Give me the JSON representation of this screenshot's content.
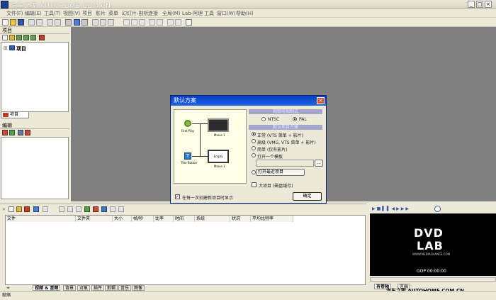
{
  "window": {
    "watermark": "汽车之家 AUTOHOME.COM.CN",
    "minimize": "_",
    "maximize": "□",
    "close": "×"
  },
  "menu": [
    "文件(F)",
    "编辑(E)",
    "工具(T)",
    "视图(V)",
    "项目",
    "影片",
    "菜单",
    "幻灯片-剖析",
    "连接",
    "全局(M)",
    "Lab-阿理",
    "工具",
    "窗口(W)",
    "帮助(H)"
  ],
  "project_panel": {
    "title": "项目",
    "tree_root": "项目",
    "tab": "项目"
  },
  "props_panel": {
    "title": "编辑"
  },
  "dialog": {
    "title": "默认方案",
    "video_section": "视频电视制式",
    "ntsc": "NTSC",
    "pal": "PAL",
    "project_section": "默认项目方案",
    "opt_normal": "正常 (VTS 菜单 + 影片)",
    "opt_advanced": "高级 (VMG, VTS 菜单 + 影片)",
    "opt_simple": "简单 (仅有影片)",
    "opt_template": "打开一个模板",
    "browse": "...",
    "recent": "打开最近项目",
    "large": "大项目 (磁盘缓存)",
    "startup": "在每一次创建新项目时显示",
    "ok": "确定",
    "preview": {
      "first_play": "First Play",
      "movie_top": "Movie 1",
      "title_button": "Title Button",
      "empty": "Empty",
      "movie_bottom": "Movie 1"
    }
  },
  "asset_table": {
    "columns": [
      "文件",
      "文件夹",
      "大小",
      "帧/秒",
      "比率",
      "时间",
      "系统",
      "状况",
      "平均比特率"
    ],
    "tabs": [
      "视频 & 音频",
      "背景",
      "对象",
      "插件",
      "剪辑",
      "音乐",
      "图像"
    ]
  },
  "player": {
    "logo_top": "DVD",
    "logo_bottom": "LAB",
    "site": "WWW.MEDIACHANCE.COM",
    "gop": "GOP 00:00:00",
    "tab_active": "有卷轴",
    "tab_other": "言画",
    "watermark": "汽车之家 AUTOHOME.COM.CN"
  },
  "status": "就绪",
  "colors": {
    "workspace": "#808080",
    "dialog_title": "#0a3dc8",
    "section": "#a4a6cc"
  }
}
